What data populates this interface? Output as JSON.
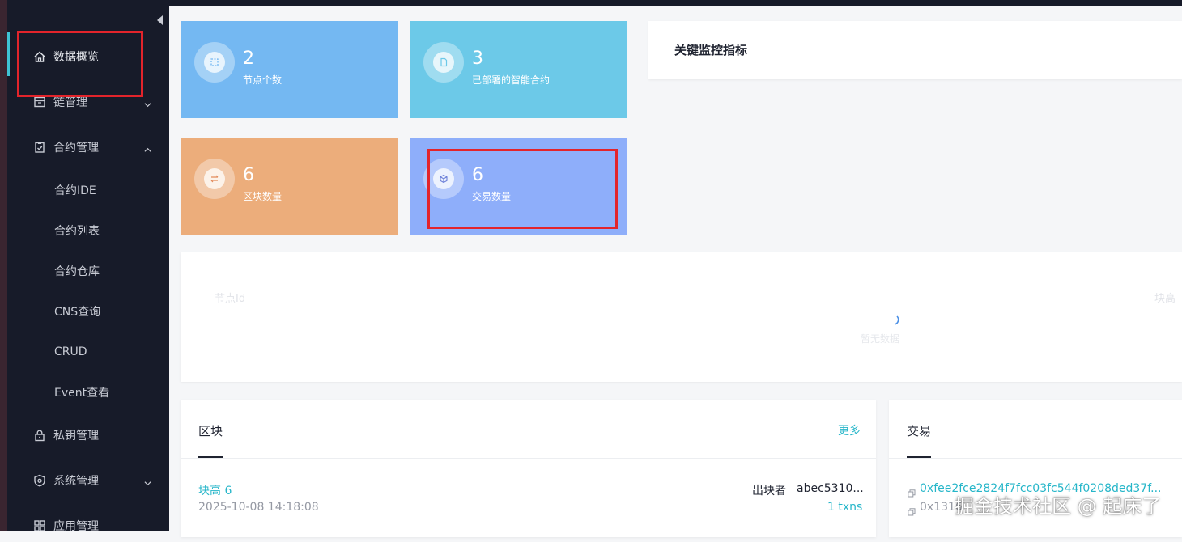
{
  "sidebar": {
    "items": [
      {
        "label": "数据概览",
        "icon": "home-icon"
      },
      {
        "label": "链管理",
        "icon": "chain-icon"
      },
      {
        "label": "合约管理",
        "icon": "contract-icon"
      },
      {
        "label": "私钥管理",
        "icon": "lock-icon"
      },
      {
        "label": "系统管理",
        "icon": "shield-icon"
      },
      {
        "label": "应用管理",
        "icon": "apps-icon"
      }
    ],
    "contract_sub": [
      "合约IDE",
      "合约列表",
      "合约仓库",
      "CNS查询",
      "CRUD",
      "Event查看"
    ]
  },
  "stats": [
    {
      "value": "2",
      "label": "节点个数",
      "color": "#74b8f2",
      "icon": "node-icon"
    },
    {
      "value": "3",
      "label": "已部署的智能合约",
      "color": "#6cc9e8",
      "icon": "document-icon"
    },
    {
      "value": "6",
      "label": "区块数量",
      "color": "#ecad7b",
      "icon": "transfer-icon"
    },
    {
      "value": "6",
      "label": "交易数量",
      "color": "#8eaefa",
      "icon": "cube-icon"
    }
  ],
  "monitor": {
    "title": "关键监控指标"
  },
  "node_table": {
    "col_node": "节点Id",
    "col_block": "块高",
    "loading_text": "暂无数据"
  },
  "blocks": {
    "title": "区块",
    "more": "更多",
    "row": {
      "height": "块高 6",
      "time": "2025-10-08 14:18:08",
      "producer_label": "出块者",
      "producer": "abec5310...",
      "txns": "1 txns"
    }
  },
  "transactions": {
    "title": "交易",
    "rows": [
      {
        "hash": "0xfee2fce2824f7fcc03fc544f0208ded37f..."
      },
      {
        "hash": "0x1316"
      }
    ]
  },
  "watermark": "掘金技术社区 @ 起床了",
  "colors": {
    "accent": "#26b6c9",
    "highlight": "#e3242b",
    "sidebar_bg": "#171b29"
  }
}
